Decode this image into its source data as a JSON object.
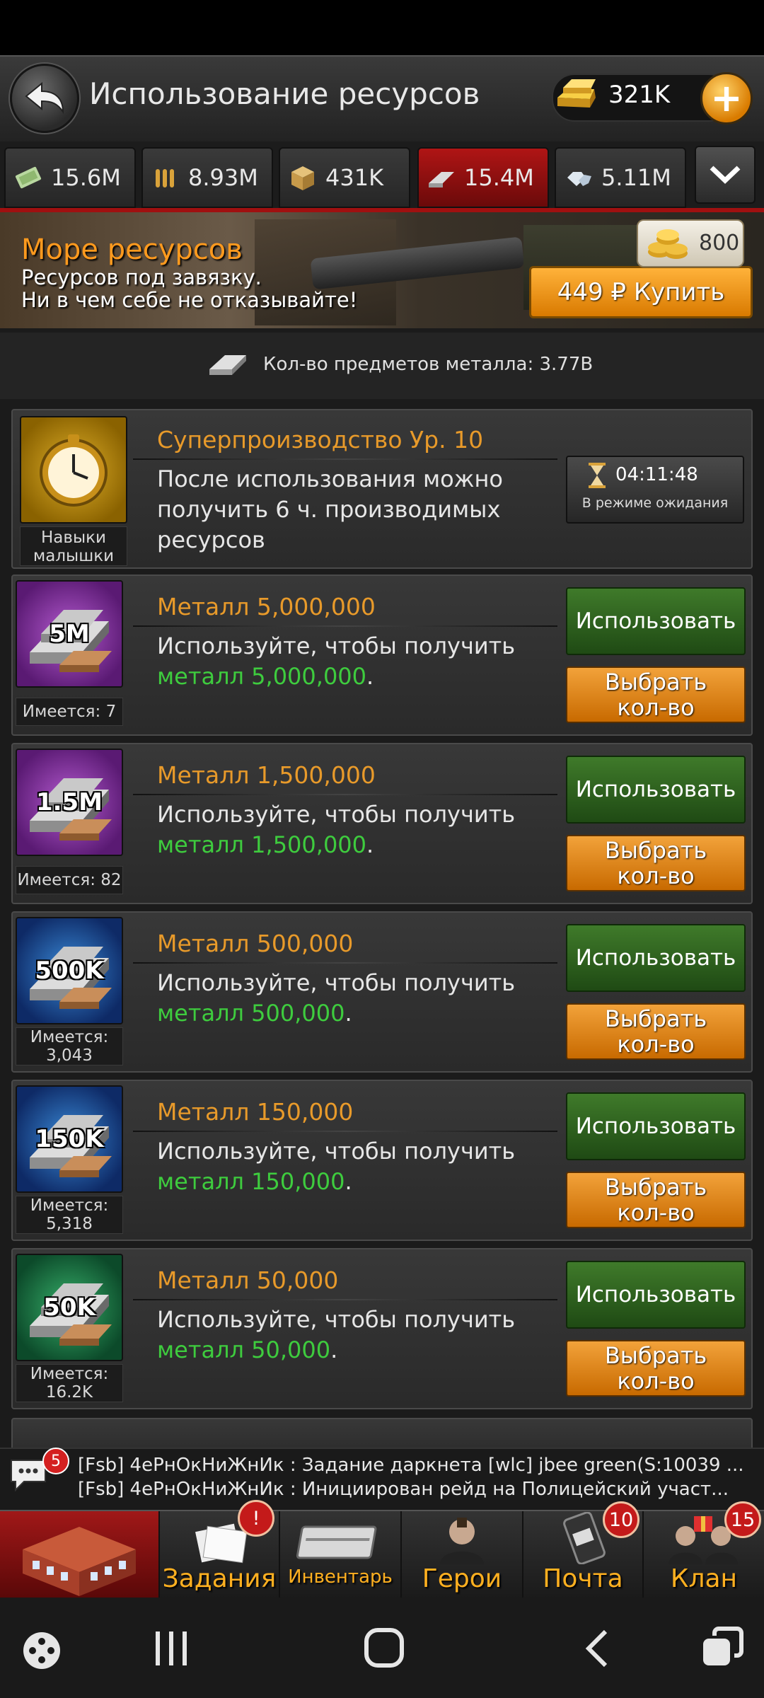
{
  "header": {
    "title": "Использование ресурсов",
    "gold": "321K"
  },
  "tabs": [
    {
      "icon": "cash-icon",
      "value": "15.6M"
    },
    {
      "icon": "ammo-icon",
      "value": "8.93M"
    },
    {
      "icon": "goods-crate-icon",
      "value": "431K"
    },
    {
      "icon": "metal-bars-icon",
      "value": "15.4M",
      "active": true
    },
    {
      "icon": "diamonds-icon",
      "value": "5.11M"
    }
  ],
  "banner": {
    "title": "Море ресурсов",
    "line1": "Ресурсов под завязку.",
    "line2": "Ни в чем себе не отказывайте!",
    "coins": "800",
    "buy_label": "449 ₽ Купить"
  },
  "metal_count": "Кол-во предметов металла: 3.77B",
  "super": {
    "icon_label_1": "Навыки",
    "icon_label_2": "малышки",
    "name": "Суперпроизводство Ур. 10",
    "desc_1": "После использования можно",
    "desc_2": "получить 6 ч. производимых",
    "desc_3": "ресурсов",
    "timer": "04:11:48",
    "status": "В режиме ожидания"
  },
  "items": [
    {
      "amount": "5M",
      "have_1": "Имеется: 7",
      "have_2": "",
      "name": "Металл 5,000,000",
      "desc": "Используйте, чтобы получить",
      "desc_green": "металл 5,000,000",
      "use": "Использовать",
      "pick_1": "Выбрать",
      "pick_2": "кол-во"
    },
    {
      "amount": "1.5M",
      "have_1": "Имеется: 82",
      "have_2": "",
      "name": "Металл 1,500,000",
      "desc": "Используйте, чтобы получить",
      "desc_green": "металл 1,500,000",
      "use": "Использовать",
      "pick_1": "Выбрать",
      "pick_2": "кол-во"
    },
    {
      "amount": "500K",
      "have_1": "Имеется:",
      "have_2": "3,043",
      "name": "Металл 500,000",
      "desc": "Используйте, чтобы получить",
      "desc_green": "металл 500,000",
      "use": "Использовать",
      "pick_1": "Выбрать",
      "pick_2": "кол-во"
    },
    {
      "amount": "150K",
      "have_1": "Имеется:",
      "have_2": "5,318",
      "name": "Металл 150,000",
      "desc": "Используйте, чтобы получить",
      "desc_green": "металл 150,000",
      "use": "Использовать",
      "pick_1": "Выбрать",
      "pick_2": "кол-во"
    },
    {
      "amount": "50K",
      "have_1": "Имеется:",
      "have_2": "16.2K",
      "name": "Металл 50,000",
      "desc": "Используйте, чтобы получить",
      "desc_green": "металл 50,000",
      "use": "Использовать",
      "pick_1": "Выбрать",
      "pick_2": "кол-во"
    }
  ],
  "chat": {
    "badge": "5",
    "line1": "[Fsb] 4еРнОкНиЖнИк : Задание даркнета [wlc] jbee green(S:10039 ...",
    "line2": "[Fsb] 4еРнОкНиЖнИк : Инициирован рейд на Полицейский участ..."
  },
  "nav": {
    "tasks": "Задания",
    "inventory": "Инвентарь",
    "heroes": "Герои",
    "mail": "Почта",
    "mail_badge": "10",
    "clan": "Клан",
    "clan_badge": "15"
  }
}
